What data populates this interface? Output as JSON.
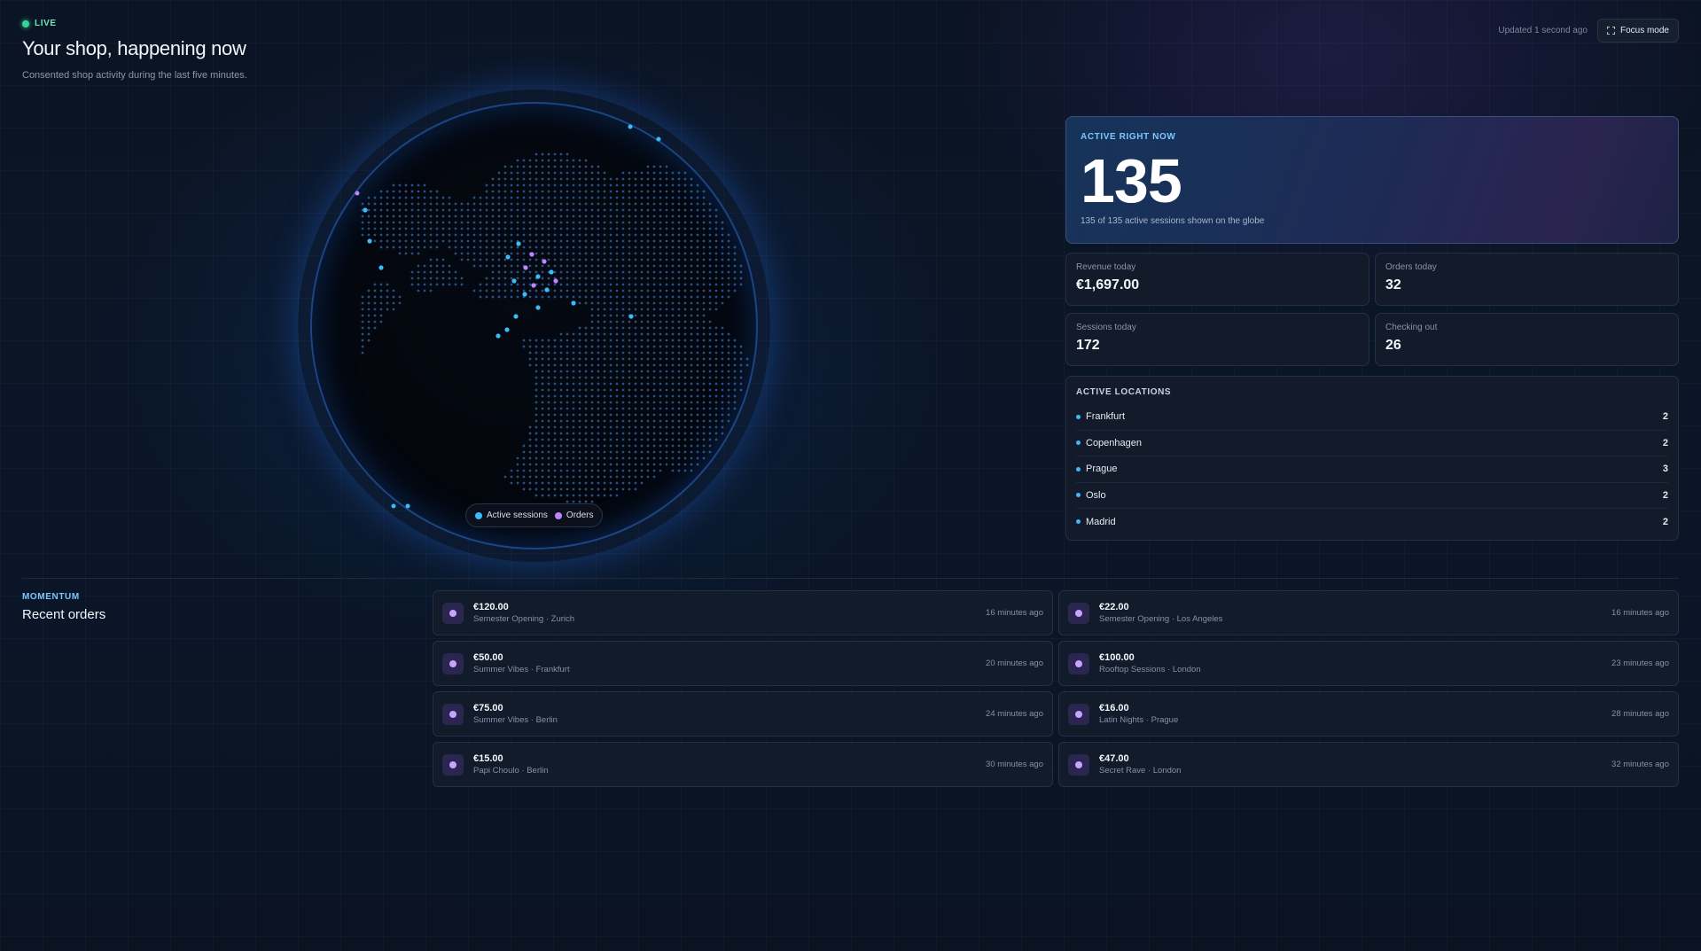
{
  "header": {
    "live_label": "LIVE",
    "title": "Your shop, happening now",
    "subtitle": "Consented shop activity during the last five minutes.",
    "updated": "Updated 1 second ago",
    "focus_label": "Focus mode"
  },
  "globe": {
    "legend": {
      "sessions_label": "Active sessions",
      "orders_label": "Orders"
    },
    "colors": {
      "sessions": "#38bdf8",
      "orders": "#c084fc"
    }
  },
  "active": {
    "label": "ACTIVE RIGHT NOW",
    "value": "135",
    "sub": "135 of 135 active sessions shown on the globe"
  },
  "stats": [
    {
      "label": "Revenue today",
      "value": "€1,697.00"
    },
    {
      "label": "Orders today",
      "value": "32"
    },
    {
      "label": "Sessions today",
      "value": "172"
    },
    {
      "label": "Checking out",
      "value": "26"
    }
  ],
  "locations": {
    "heading": "ACTIVE LOCATIONS",
    "items": [
      {
        "name": "Frankfurt",
        "count": "2"
      },
      {
        "name": "Copenhagen",
        "count": "2"
      },
      {
        "name": "Prague",
        "count": "3"
      },
      {
        "name": "Oslo",
        "count": "2"
      },
      {
        "name": "Madrid",
        "count": "2"
      }
    ]
  },
  "momentum": {
    "label": "MOMENTUM",
    "title": "Recent orders",
    "orders": [
      {
        "amount": "€120.00",
        "meta": "Semester Opening · Zurich",
        "time": "16 minutes ago"
      },
      {
        "amount": "€22.00",
        "meta": "Semester Opening · Los Angeles",
        "time": "16 minutes ago"
      },
      {
        "amount": "€50.00",
        "meta": "Summer Vibes · Frankfurt",
        "time": "20 minutes ago"
      },
      {
        "amount": "€100.00",
        "meta": "Rooftop Sessions · London",
        "time": "23 minutes ago"
      },
      {
        "amount": "€75.00",
        "meta": "Summer Vibes · Berlin",
        "time": "24 minutes ago"
      },
      {
        "amount": "€16.00",
        "meta": "Latin Nights · Prague",
        "time": "28 minutes ago"
      },
      {
        "amount": "€15.00",
        "meta": "Papi Choulo · Berlin",
        "time": "30 minutes ago"
      },
      {
        "amount": "€47.00",
        "meta": "Secret Rave · London",
        "time": "32 minutes ago"
      }
    ]
  }
}
